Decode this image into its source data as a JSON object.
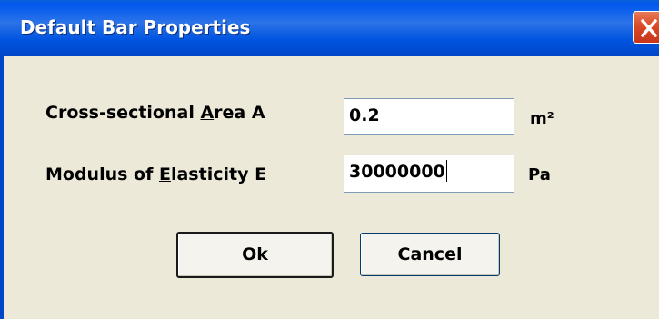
{
  "window": {
    "title": "Default Bar Properties",
    "close_icon": "close-icon"
  },
  "form": {
    "area": {
      "label_pre": "Cross-sectional ",
      "label_mnemonic": "A",
      "label_post": "rea A",
      "value": "0.2",
      "unit": "m²"
    },
    "modulus": {
      "label_pre": "Modulus of ",
      "label_mnemonic": "E",
      "label_post": "lasticity E",
      "value": "30000000",
      "unit": "Pa"
    }
  },
  "buttons": {
    "ok_label": "Ok",
    "cancel_label": "Cancel"
  }
}
